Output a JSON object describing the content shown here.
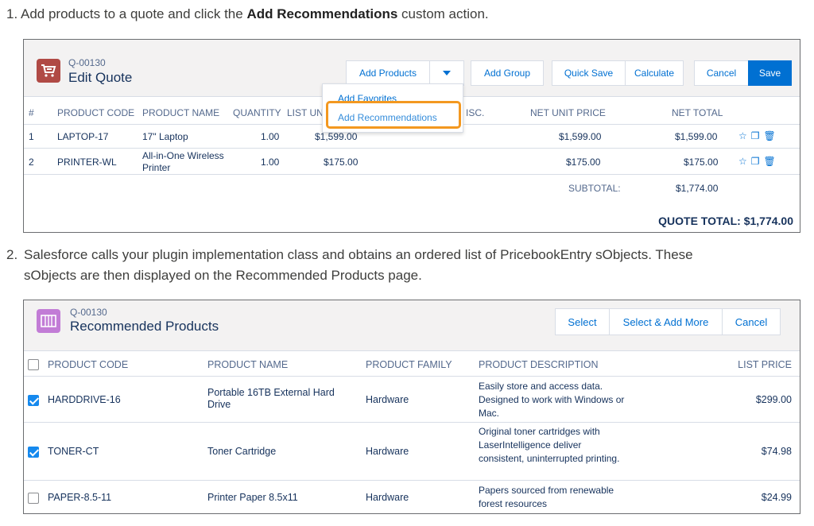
{
  "steps": {
    "step1_num": "1.",
    "step1_pre": "Add products to a quote and click the ",
    "step1_bold": "Add Recommendations",
    "step1_post": " custom action.",
    "step2_num": "2.",
    "step2_line1": "Salesforce calls your plugin implementation class and obtains an ordered list of PricebookEntry sObjects. These",
    "step2_line2": "sObjects are then displayed on the Recommended Products page."
  },
  "edit_quote": {
    "record_id": "Q-00130",
    "title": "Edit Quote",
    "icon": "cart-icon",
    "buttons": {
      "add_products": "Add Products",
      "add_group": "Add Group",
      "quick_save": "Quick Save",
      "calculate": "Calculate",
      "cancel": "Cancel",
      "save": "Save"
    },
    "dropdown": {
      "add_favorites": "Add Favorites",
      "add_recommendations": "Add Recommendations"
    },
    "columns": {
      "num": "#",
      "code": "PRODUCT CODE",
      "name": "PRODUCT NAME",
      "qty": "QUANTITY",
      "list": "LIST UN",
      "disc": "ISC.",
      "net_unit": "NET UNIT PRICE",
      "net_total": "NET TOTAL"
    },
    "rows": [
      {
        "num": "1",
        "code": "LAPTOP-17",
        "name": "17\" Laptop",
        "qty": "1.00",
        "list": "$1,599.00",
        "net_unit": "$1,599.00",
        "net_total": "$1,599.00"
      },
      {
        "num": "2",
        "code": "PRINTER-WL",
        "name": "All-in-One Wireless Printer",
        "qty": "1.00",
        "list": "$175.00",
        "net_unit": "$175.00",
        "net_total": "$175.00"
      }
    ],
    "subtotal_label": "SUBTOTAL:",
    "subtotal_value": "$1,774.00",
    "quote_total": "QUOTE TOTAL: $1,774.00"
  },
  "recommended": {
    "record_id": "Q-00130",
    "title": "Recommended Products",
    "icon": "product-grid-icon",
    "buttons": {
      "select": "Select",
      "select_add_more": "Select & Add More",
      "cancel": "Cancel"
    },
    "columns": {
      "code": "PRODUCT CODE",
      "name": "PRODUCT NAME",
      "family": "PRODUCT FAMILY",
      "desc": "PRODUCT DESCRIPTION",
      "price": "LIST PRICE"
    },
    "rows": [
      {
        "checked": true,
        "code": "HARDDRIVE-16",
        "name": "Portable 16TB External Hard Drive",
        "family": "Hardware",
        "desc": "Easily store and access data. Designed to work with Windows or Mac.",
        "price": "$299.00"
      },
      {
        "checked": true,
        "code": "TONER-CT",
        "name": "Toner Cartridge",
        "family": "Hardware",
        "desc": "Original toner cartridges with LaserIntelligence deliver consistent, uninterrupted printing.",
        "price": "$74.98"
      },
      {
        "checked": false,
        "code": "PAPER-8.5-11",
        "name": "Printer Paper 8.5x11",
        "family": "Hardware",
        "desc": "Papers sourced from renewable forest resources",
        "price": "$24.99"
      }
    ]
  },
  "colors": {
    "brand": "#0070d2",
    "highlight": "#f39820",
    "quote_icon": "#b04a45",
    "product_icon": "#c27cd6"
  }
}
